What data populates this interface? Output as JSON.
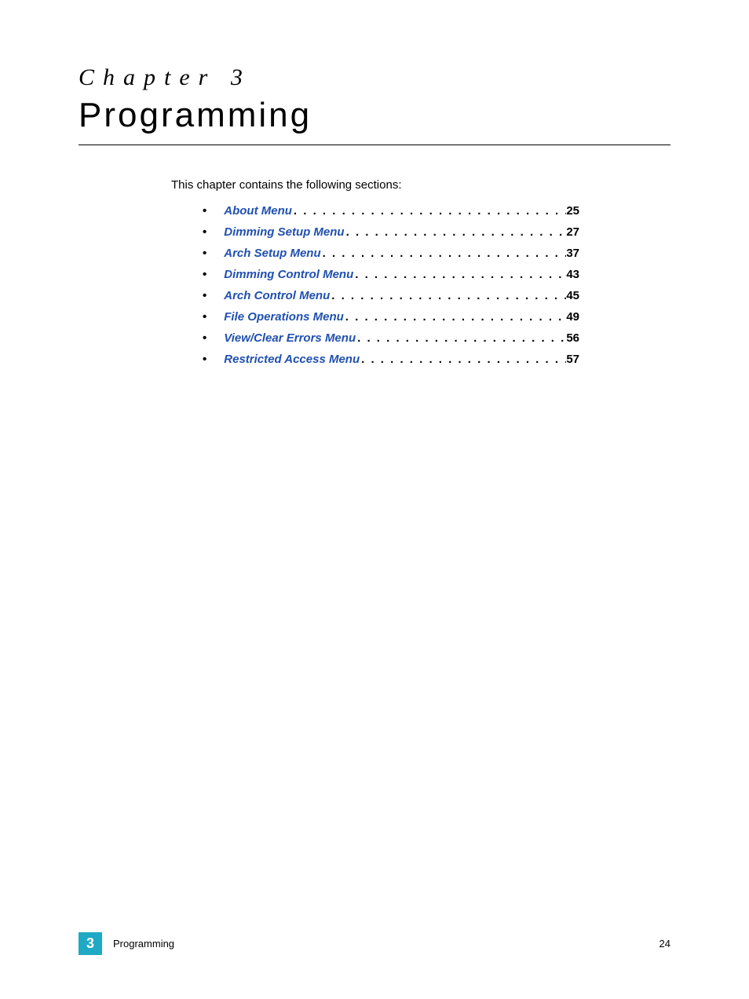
{
  "header": {
    "chapter_label": "Chapter 3",
    "chapter_title": "Programming"
  },
  "intro": "This chapter contains the following sections:",
  "toc": [
    {
      "label": "About Menu",
      "page": "25"
    },
    {
      "label": "Dimming Setup Menu",
      "page": "27"
    },
    {
      "label": "Arch Setup Menu",
      "page": "37"
    },
    {
      "label": "Dimming Control Menu",
      "page": "43"
    },
    {
      "label": "Arch Control Menu",
      "page": "45"
    },
    {
      "label": "File Operations Menu",
      "page": "49"
    },
    {
      "label": "View/Clear Errors Menu",
      "page": "56"
    },
    {
      "label": "Restricted Access Menu",
      "page": "57"
    }
  ],
  "footer": {
    "chapter_number": "3",
    "chapter_name": "Programming",
    "page_number": "24"
  }
}
